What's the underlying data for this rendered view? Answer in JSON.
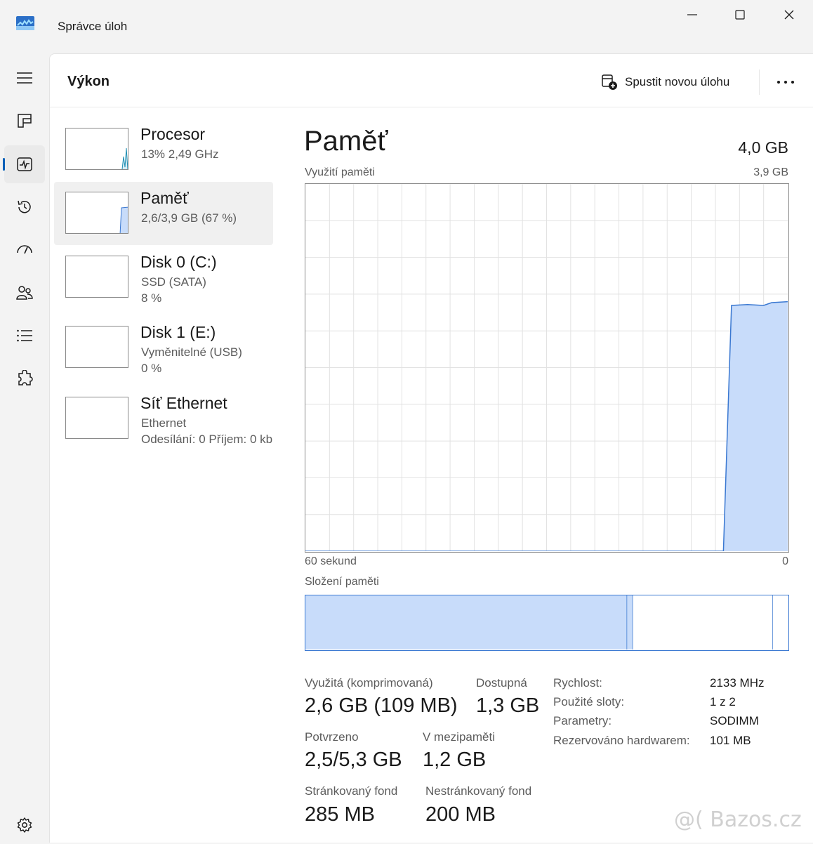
{
  "window": {
    "title": "Správce úloh"
  },
  "header": {
    "title": "Výkon",
    "run_task_label": "Spustit novou úlohu"
  },
  "perf_items": [
    {
      "name": "Procesor",
      "line1": "13%  2,49 GHz",
      "line2": ""
    },
    {
      "name": "Paměť",
      "line1": "2,6/3,9 GB (67 %)",
      "line2": ""
    },
    {
      "name": "Disk 0 (C:)",
      "line1": "SSD (SATA)",
      "line2": "8 %"
    },
    {
      "name": "Disk 1 (E:)",
      "line1": "Vyměnitelné (USB)",
      "line2": "0 %"
    },
    {
      "name": "Síť Ethernet",
      "line1": "Ethernet",
      "line2": "Odesílání: 0 Příjem: 0 kb"
    }
  ],
  "detail": {
    "title": "Paměť",
    "total": "4,0 GB",
    "usage_label": "Využití paměti",
    "usage_max": "3,9 GB",
    "time_left": "60 sekund",
    "time_right": "0",
    "composition_label": "Složení paměti"
  },
  "stats": {
    "in_use_label": "Využitá (komprimovaná)",
    "in_use_value": "2,6 GB (109 MB)",
    "available_label": "Dostupná",
    "available_value": "1,3 GB",
    "committed_label": "Potvrzeno",
    "committed_value": "2,5/5,3 GB",
    "cached_label": "V mezipaměti",
    "cached_value": "1,2 GB",
    "paged_label": "Stránkovaný fond",
    "paged_value": "285 MB",
    "nonpaged_label": "Nestránkovaný fond",
    "nonpaged_value": "200 MB"
  },
  "properties": [
    {
      "key": "Rychlost:",
      "value": "2133 MHz"
    },
    {
      "key": "Použité sloty:",
      "value": "1 z 2"
    },
    {
      "key": "Parametry:",
      "value": "SODIMM"
    },
    {
      "key": "Rezervováno hardwarem:",
      "value": "101 MB"
    }
  ],
  "chart_data": {
    "type": "area",
    "title": "Využití paměti",
    "xlabel": "60 sekund",
    "ylim": [
      0,
      3.9
    ],
    "y_unit": "GB",
    "x_seconds_ago": [
      60,
      8,
      7,
      5,
      3,
      2,
      0
    ],
    "series": [
      {
        "values": [
          0,
          0,
          2.61,
          2.62,
          2.61,
          2.64,
          2.65
        ]
      }
    ],
    "grid": true
  },
  "composition": {
    "in_use_fraction": 0.667,
    "modified_fraction": 0.012,
    "standby_fraction": 0.29,
    "free_fraction": 0.031
  },
  "colors": {
    "accent": "#005fb8",
    "memory_line": "#3a78d1",
    "memory_fill": "#c8dcfa"
  },
  "watermark": "@( Bazos.cz"
}
